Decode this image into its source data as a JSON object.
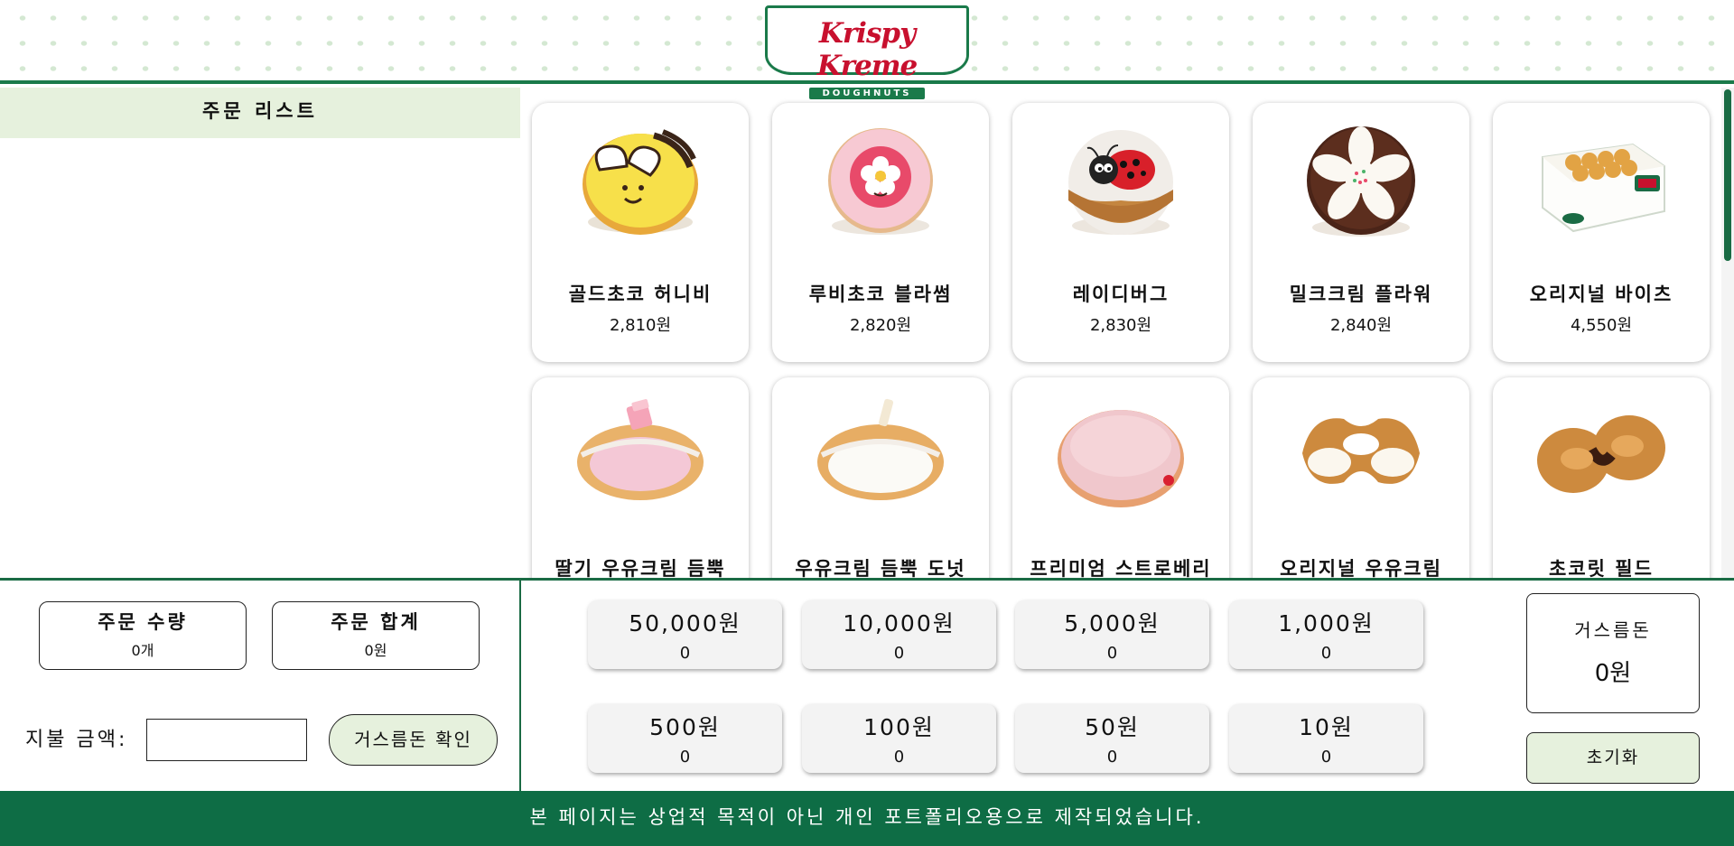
{
  "brand": {
    "logo_script": "Krispy Kreme",
    "logo_tag": "DOUGHNUTS",
    "colors": {
      "primary_green": "#1a6b44",
      "brand_red": "#c8102e",
      "soft_green": "#e6f1dd"
    }
  },
  "order_list": {
    "title": "주문 리스트"
  },
  "products": [
    {
      "name": "골드초코 허니비",
      "price": "2,810원",
      "icon": "honeybee-donut-image"
    },
    {
      "name": "루비초코 블라썸",
      "price": "2,820원",
      "icon": "ruby-blossom-donut-image"
    },
    {
      "name": "레이디버그",
      "price": "2,830원",
      "icon": "ladybug-donut-image"
    },
    {
      "name": "밀크크림 플라워",
      "price": "2,840원",
      "icon": "milk-cream-flower-donut-image"
    },
    {
      "name": "오리지널 바이츠",
      "price": "4,550원",
      "icon": "original-bites-box-image"
    },
    {
      "name": "딸기 우유크림 듬뿍",
      "price": "",
      "icon": "strawberry-milk-cream-donut-image"
    },
    {
      "name": "우유크림 듬뿍 도넛",
      "price": "",
      "icon": "milk-cream-donut-image"
    },
    {
      "name": "프리미엄 스트로베리",
      "price": "",
      "icon": "premium-strawberry-donut-image"
    },
    {
      "name": "오리지널 우유크림",
      "price": "",
      "icon": "original-milk-cream-donut-image"
    },
    {
      "name": "초코릿 필드",
      "price": "",
      "icon": "chocolate-filled-donut-image"
    }
  ],
  "summary": {
    "quantity_label": "주문 수량",
    "quantity_value": "0개",
    "total_label": "주문 합계",
    "total_value": "0원"
  },
  "payment": {
    "label": "지불 금액:",
    "input_value": "",
    "input_placeholder": "",
    "confirm_label": "거스름돈 확인"
  },
  "cash": [
    {
      "denom": "50,000원",
      "count": "0"
    },
    {
      "denom": "10,000원",
      "count": "0"
    },
    {
      "denom": "5,000원",
      "count": "0"
    },
    {
      "denom": "1,000원",
      "count": "0"
    },
    {
      "denom": "500원",
      "count": "0"
    },
    {
      "denom": "100원",
      "count": "0"
    },
    {
      "denom": "50원",
      "count": "0"
    },
    {
      "denom": "10원",
      "count": "0"
    }
  ],
  "change": {
    "label": "거스름돈",
    "value": "0원"
  },
  "reset_label": "초기화",
  "footer": "본 페이지는 상업적 목적이 아닌 개인 포트폴리오용으로 제작되었습니다."
}
